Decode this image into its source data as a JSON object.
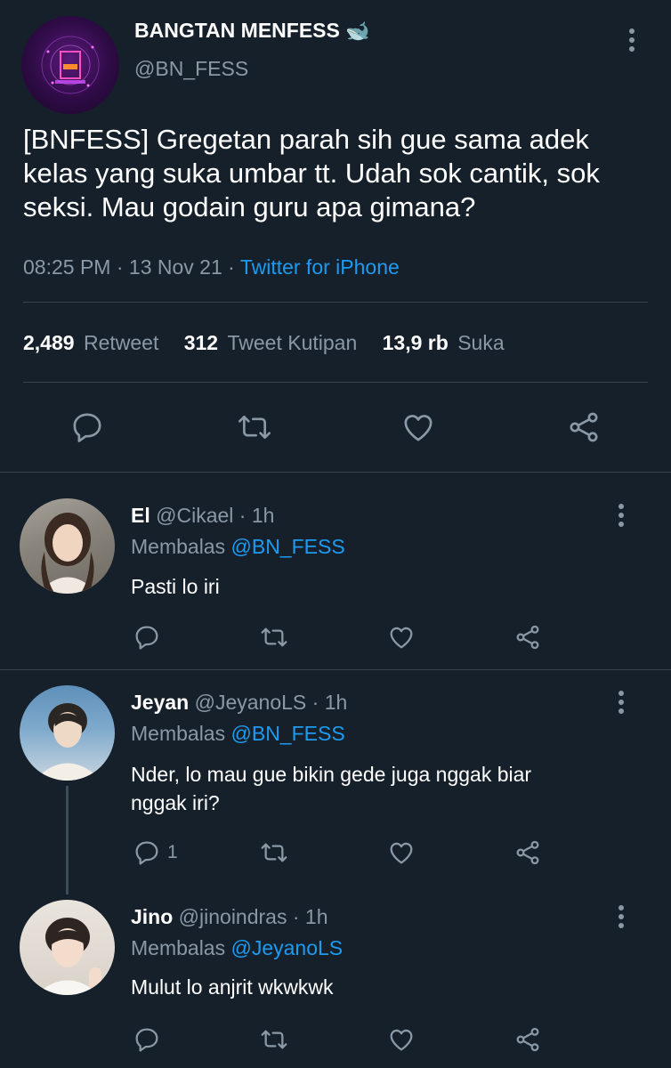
{
  "main_tweet": {
    "display_name": "BANGTAN MENFESS",
    "emoji": "🐋",
    "handle": "@BN_FESS",
    "text_line1": "[BNFESS] Gregetan parah sih gue sama adek",
    "text_line2": "kelas yang suka umbar tt. Udah sok cantik, sok",
    "text_line3": "seksi. Mau godain guru apa gimana?",
    "time": "08:25 PM",
    "date": "13 Nov 21",
    "separator": "·",
    "source": "Twitter for iPhone",
    "retweet_count": "2,489",
    "retweet_label": "Retweet",
    "quote_count": "312",
    "quote_label": "Tweet Kutipan",
    "like_count": "13,9 rb",
    "like_label": "Suka"
  },
  "replies": [
    {
      "name": "El",
      "handle": "@Cikael",
      "time": "1h",
      "replying_label": "Membalas",
      "replying_to": "@BN_FESS",
      "text_line1": "Pasti lo iri",
      "text_line2": "",
      "reply_count": ""
    },
    {
      "name": "Jeyan",
      "handle": "@JeyanoLS",
      "time": "1h",
      "replying_label": "Membalas",
      "replying_to": "@BN_FESS",
      "text_line1": "Nder, lo mau gue bikin gede juga nggak biar",
      "text_line2": "nggak iri?",
      "reply_count": "1"
    },
    {
      "name": "Jino",
      "handle": "@jinoindras",
      "time": "1h",
      "replying_label": "Membalas",
      "replying_to": "@JeyanoLS",
      "text_line1": "Mulut lo anjrit wkwkwk",
      "text_line2": "",
      "reply_count": ""
    }
  ],
  "colors": {
    "background": "#15202b",
    "accent": "#1d9bf0",
    "muted": "#8b98a5",
    "divider": "#38444d"
  }
}
